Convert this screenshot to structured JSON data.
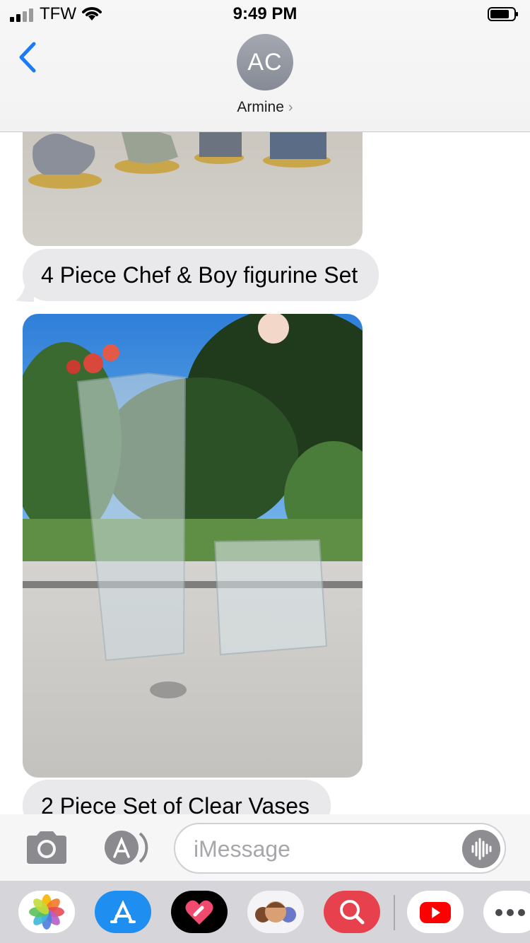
{
  "status_bar": {
    "carrier": "TFW",
    "time": "9:49 PM"
  },
  "header": {
    "avatar_initials": "AC",
    "contact_name": "Armine",
    "chevron": "›"
  },
  "thread": {
    "messages": [
      {
        "type": "image",
        "description_icon": "figurines-photo"
      },
      {
        "type": "text",
        "text": "4 Piece Chef & Boy figurine Set"
      },
      {
        "type": "image",
        "description_icon": "vases-photo"
      },
      {
        "type": "text",
        "text": "2 Piece Set of Clear Vases"
      }
    ]
  },
  "input_bar": {
    "placeholder": "iMessage",
    "value": ""
  },
  "app_drawer": {
    "apps": [
      "photos-icon",
      "app-store-icon",
      "digital-touch-icon",
      "memoji-icon",
      "images-search-icon",
      "youtube-icon",
      "more-icon"
    ]
  },
  "colors": {
    "accent": "#007aff",
    "bubble_gray": "#e9e9eb",
    "avatar_gray": "#9a9da6"
  }
}
